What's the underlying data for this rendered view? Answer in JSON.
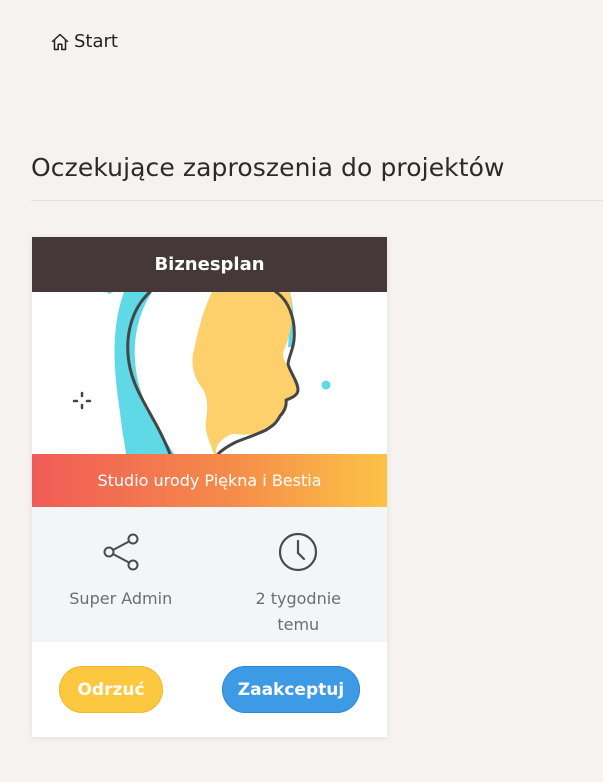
{
  "breadcrumb": {
    "icon": "home-icon",
    "label": "Start"
  },
  "page": {
    "title": "Oczekujące zaproszenia do projektów"
  },
  "invitation": {
    "project_name": "Biznesplan",
    "organization": "Studio urody Piękna i Bestia",
    "shared_by": {
      "icon": "share-icon",
      "text": "Super Admin"
    },
    "time": {
      "icon": "clock-icon",
      "text": "2 tygodnie temu"
    },
    "reject_label": "Odrzuć",
    "accept_label": "Zaakceptuj"
  },
  "colors": {
    "background": "#f5f2ef",
    "card_header": "#443838",
    "banner_gradient_start": "#f05b57",
    "banner_gradient_end": "#fcc346",
    "reject_button": "#fbc83f",
    "accept_button": "#3d9ae4",
    "illustration_head": "#fdd06b",
    "illustration_accent": "#5fd9e6"
  }
}
